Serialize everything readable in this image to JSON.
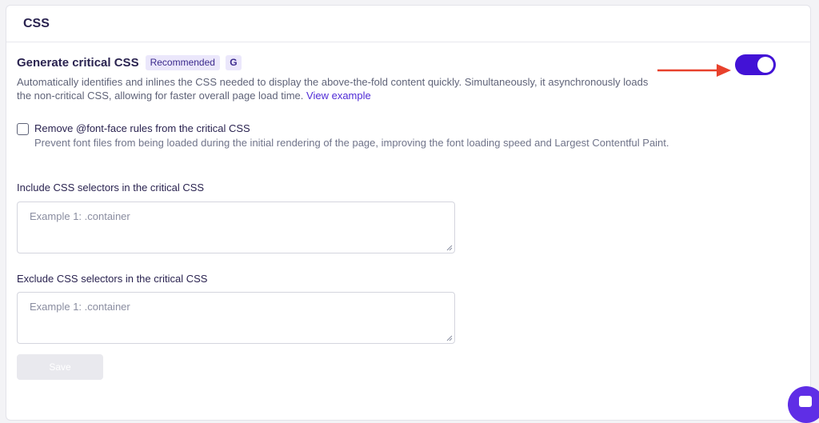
{
  "section": {
    "title": "CSS"
  },
  "critical_css": {
    "title": "Generate critical CSS",
    "badge_recommended": "Recommended",
    "badge_g": "G",
    "description": "Automatically identifies and inlines the CSS needed to display the above-the-fold content quickly. Simultaneously, it asynchronously loads the non-critical CSS, allowing for faster overall page load time.",
    "view_example": "View example",
    "toggle_on": true
  },
  "remove_font_face": {
    "label": "Remove @font-face rules from the critical CSS",
    "description": "Prevent font files from being loaded during the initial rendering of the page, improving the font loading speed and Largest Contentful Paint.",
    "checked": false
  },
  "include_selectors": {
    "label": "Include CSS selectors in the critical CSS",
    "placeholder": "Example 1: .container"
  },
  "exclude_selectors": {
    "label": "Exclude CSS selectors in the critical CSS",
    "placeholder": "Example 1: .container"
  },
  "save": {
    "label": "Save"
  },
  "colors": {
    "accent": "#4212d6",
    "arrow": "#e8412c",
    "badge_bg": "#ebe7fb",
    "chat": "#5f2ee6"
  },
  "icons": {
    "arrow": "arrow-right-icon",
    "chat": "chat-icon",
    "resize": "resize-handle-icon"
  }
}
